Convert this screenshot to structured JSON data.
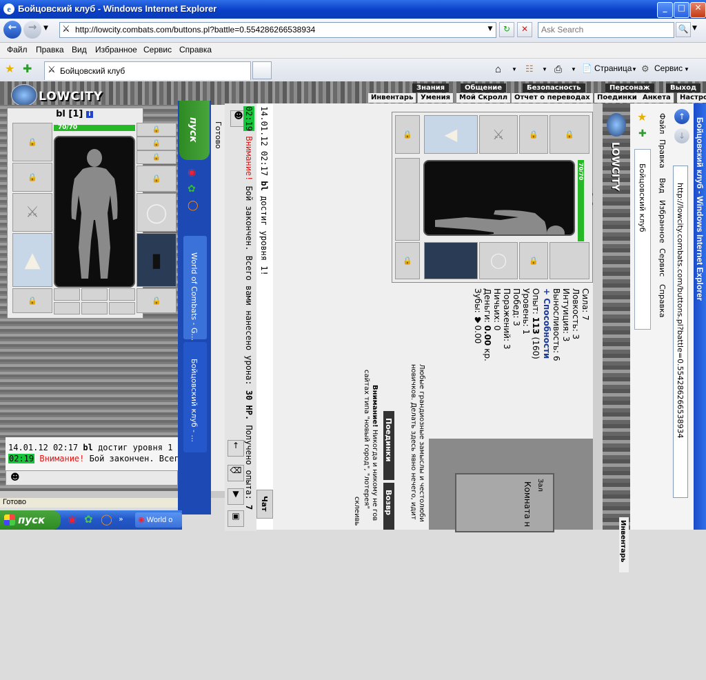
{
  "window": {
    "title": "Бойцовский клуб - Windows Internet Explorer",
    "minimize": "_",
    "maximize": "□",
    "close": "✕"
  },
  "navbar": {
    "url": "http://lowcity.combats.com/buttons.pl?battle=0.554286266538934",
    "search_placeholder": "Ask Search"
  },
  "menu": [
    "Файл",
    "Правка",
    "Вид",
    "Избранное",
    "Сервис",
    "Справка"
  ],
  "tabbar": {
    "tab_title": "Бойцовский клуб",
    "page_label": "Страница",
    "service_label": "Сервис"
  },
  "game": {
    "logo": "LOWCITY",
    "top_nav": [
      "Знания",
      "Общение",
      "Безопасность",
      "Персонаж",
      "Выход"
    ],
    "sub_nav": [
      "Инвентарь",
      "Умения",
      "Мой Скролл",
      "Отчет о переводах",
      "Поединки",
      "Анкета",
      "Настро"
    ],
    "character": {
      "name": "bl",
      "level": "[1]",
      "info": "i",
      "hp": "70/70",
      "hp_fraction": 1.0
    },
    "chat": {
      "line1_time": "14.01.12 02:17",
      "line1_user": "bl",
      "line1_text": "достиг уровня 1!",
      "line2_time": "02:19",
      "line2_warn": "Внимание!",
      "line2_text": "Бой закончен. Всего вами нанесено урона:",
      "line2_dmg": "30 HP.",
      "line2_exp": "Получено опыта:",
      "line2_exp_val": "7",
      "left_line1_text": "достиг уровня 1",
      "left_line2_text": "Бой закончен. Всег"
    },
    "stats": {
      "strength": "Сила: 7",
      "agility": "Ловкость: 3",
      "intuition": "Интуиция: 3",
      "endurance": "Выносливость: 6",
      "abilities": "+ Способности",
      "exp_label": "Опыт:",
      "exp_value": "113",
      "exp_next": "(160)",
      "level": "Уровень: 1",
      "wins": "Побед: 3",
      "losses": "Поражений: 3",
      "draws": "Ничьих: 0",
      "money_label": "Деньги:",
      "money": "0.00",
      "money_unit": "кр.",
      "teeth": "Зубы: ♥0.00"
    },
    "side_text": {
      "blurb1": "Любые грандиозные замыслы и честолюби",
      "blurb2": "новичков. Делать здесь явно нечего, идит",
      "note_bold": "Внимание!",
      "note": "Никогда и никому не гов",
      "note2": "сайтах типа \"новый город\", \"лотерея\"",
      "note3": "склеивь",
      "battles": "Поединки",
      "back": "Возвр",
      "map_sign": "Комната н",
      "map_sign2": "Зал",
      "chat_tab": "Чат",
      "inv_tab": "Инвентарь"
    },
    "status": "Готово"
  },
  "ie2": {
    "title": "Бойцовский клуб - Windows Internet Explorer",
    "url": "http://lowcity.combats.com/buttons.pl?battle=0.554286266538934",
    "tab_title": "Бойцовский клуб",
    "menu": [
      "Файл",
      "Правка",
      "Вид",
      "Избранное",
      "Сервис",
      "Справка"
    ]
  },
  "rotated_taskbar": {
    "start": "пуск",
    "task1": "World of Combats - G...",
    "task2": "Бойцовский клуб - ..."
  },
  "taskbar": {
    "start": "пуск",
    "task": "World o"
  },
  "colors": {
    "title_blue": "#0a3fc8",
    "hp_green": "#27b827",
    "warn_red": "#e81010",
    "time_green": "#17c53a"
  }
}
